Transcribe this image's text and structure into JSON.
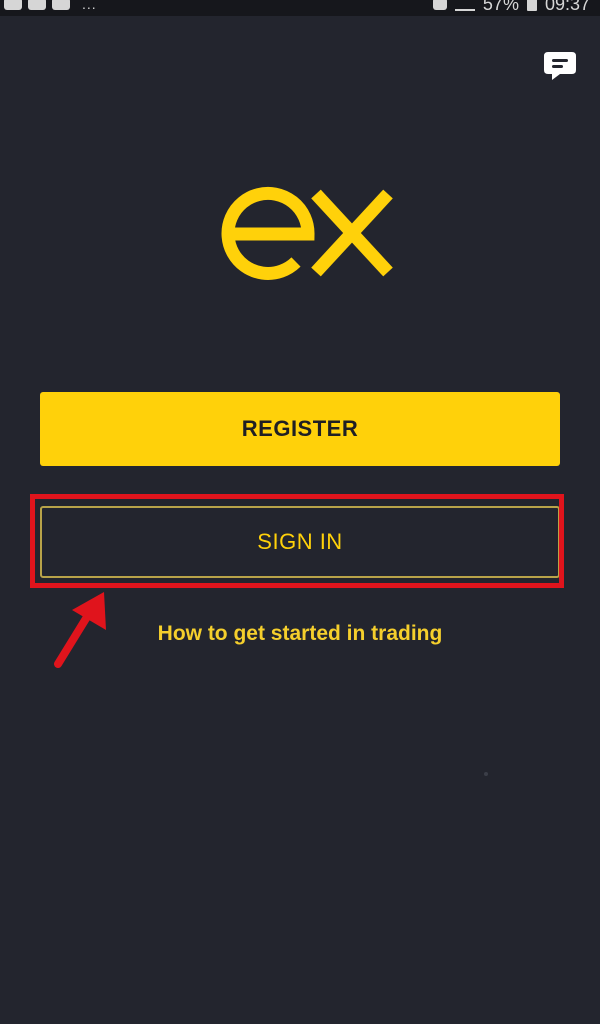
{
  "status_bar": {
    "battery_text": "57%",
    "time": "09:37",
    "dots": "..."
  },
  "header": {
    "chat_icon": "chat-bubble-icon"
  },
  "logo": {
    "text": "ex",
    "color": "#ffd10a"
  },
  "actions": {
    "register_label": "REGISTER",
    "signin_label": "SIGN IN",
    "get_started_label": "How to get started in trading"
  },
  "annotation": {
    "highlight_color": "#e0141c",
    "arrow_color": "#e0141c"
  },
  "colors": {
    "background": "#23252e",
    "accent": "#ffd10a"
  }
}
